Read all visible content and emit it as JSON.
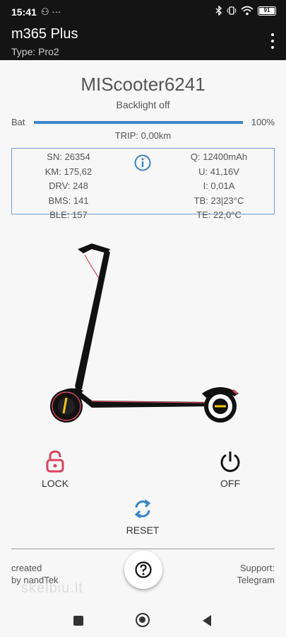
{
  "status_bar": {
    "time": "15:41",
    "notification_icons": "⚇ ···",
    "battery_level": "91"
  },
  "app_bar": {
    "title": "m365 Plus",
    "subtitle": "Type: Pro2"
  },
  "device": {
    "name": "MIScooter6241",
    "backlight": "Backlight off"
  },
  "battery": {
    "label": "Bat",
    "percent_text": "100%",
    "level": 1.0
  },
  "trip": "TRIP: 0,00km",
  "info": {
    "left": {
      "sn": "SN: 26354",
      "km": "KM: 175,62",
      "drv": "DRV: 248",
      "bms": "BMS: 141",
      "ble": "BLE: 157"
    },
    "right": {
      "q": "Q: 12400mAh",
      "u": "U: 41,16V",
      "i": "I: 0,01A",
      "tb": "TB: 23|23°C",
      "te": "TE: 22,0°C"
    }
  },
  "actions": {
    "lock": "LOCK",
    "off": "OFF",
    "reset": "RESET"
  },
  "footer": {
    "created_line1": "created",
    "created_line2": "by nandTek",
    "support_line1": "Support:",
    "support_line2": "Telegram",
    "watermark": "skelbiu.lt"
  },
  "colors": {
    "accent_blue": "#3b85c6",
    "lock_red": "#d9455f",
    "appbar_bg": "#141414"
  }
}
